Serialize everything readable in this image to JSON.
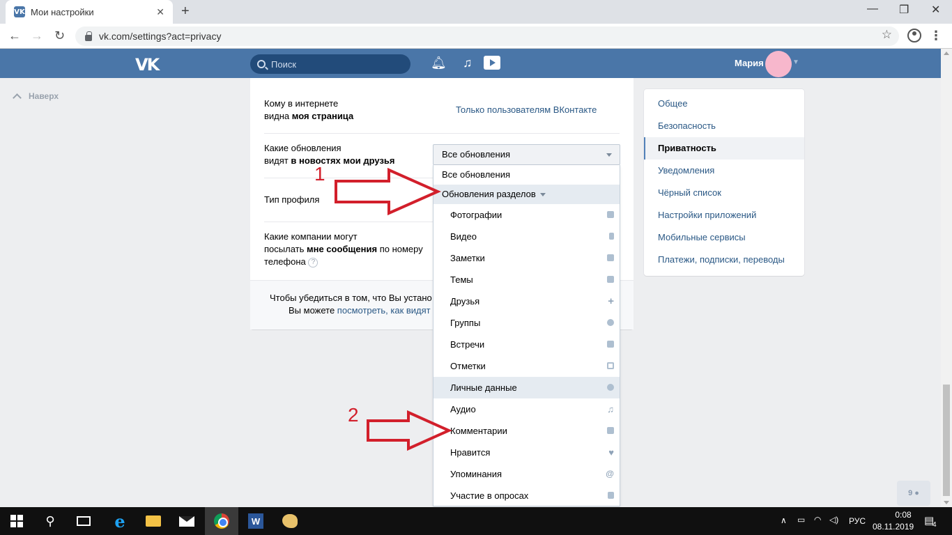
{
  "browser": {
    "tab_title": "Мои настройки",
    "tab_favicon": "VK",
    "url": "vk.com/settings?act=privacy"
  },
  "vk_header": {
    "logo": "VK",
    "search_placeholder": "Поиск",
    "user_name": "Мария"
  },
  "back_to_top": "Наверх",
  "privacy": {
    "row1": {
      "label_a": "Кому в интернете",
      "label_b_plain": "видна ",
      "label_b_bold": "моя страница",
      "value": "Только пользователям ВКонтакте"
    },
    "row2": {
      "label_a": "Какие обновления",
      "label_b_plain": "видят ",
      "label_b_bold": "в новостях мои друзья"
    },
    "row3": {
      "label": "Тип профиля"
    },
    "row4": {
      "label_a": "Какие компании могут",
      "label_b_plain": "посылать ",
      "label_b_bold": "мне сообщения",
      "label_b_rest": " по номеру",
      "label_c": "телефона",
      "help": "?"
    },
    "footer_line1": "Чтобы убедиться в том, что Вы устано",
    "footer_line2_plain": "Вы можете ",
    "footer_line2_link": "посмотреть, как видят"
  },
  "dropdown": {
    "selected": "Все обновления",
    "options": [
      {
        "label": "Все обновления"
      },
      {
        "label": "Обновления разделов"
      }
    ],
    "sections": [
      {
        "label": "Фотографии",
        "icon": "camera-icon"
      },
      {
        "label": "Видео",
        "icon": "video-icon"
      },
      {
        "label": "Заметки",
        "icon": "note-icon"
      },
      {
        "label": "Темы",
        "icon": "comment-icon"
      },
      {
        "label": "Друзья",
        "icon": "plus-icon"
      },
      {
        "label": "Группы",
        "icon": "group-icon"
      },
      {
        "label": "Встречи",
        "icon": "home-icon"
      },
      {
        "label": "Отметки",
        "icon": "tag-frame-icon"
      },
      {
        "label": "Личные данные",
        "icon": "person-icon"
      },
      {
        "label": "Аудио",
        "icon": "music-icon"
      },
      {
        "label": "Комментарии",
        "icon": "comment-icon"
      },
      {
        "label": "Нравится",
        "icon": "heart-icon"
      },
      {
        "label": "Упоминания",
        "icon": "at-icon"
      },
      {
        "label": "Участие в опросах",
        "icon": "poll-icon"
      }
    ]
  },
  "settings_menu": [
    {
      "label": "Общее"
    },
    {
      "label": "Безопасность"
    },
    {
      "label": "Приватность"
    },
    {
      "label": "Уведомления"
    },
    {
      "label": "Чёрный список"
    },
    {
      "label": "Настройки приложений"
    },
    {
      "label": "Мобильные сервисы"
    },
    {
      "label": "Платежи, подписки, переводы"
    }
  ],
  "annotations": {
    "one": "1",
    "two": "2"
  },
  "friends_fab": "9",
  "taskbar": {
    "language": "РУС",
    "time": "0:08",
    "date": "08.11.2019",
    "notifications": "4"
  },
  "colors": {
    "vk_blue": "#4a76a8",
    "link": "#2a5885",
    "annotation_red": "#d21f2b"
  }
}
